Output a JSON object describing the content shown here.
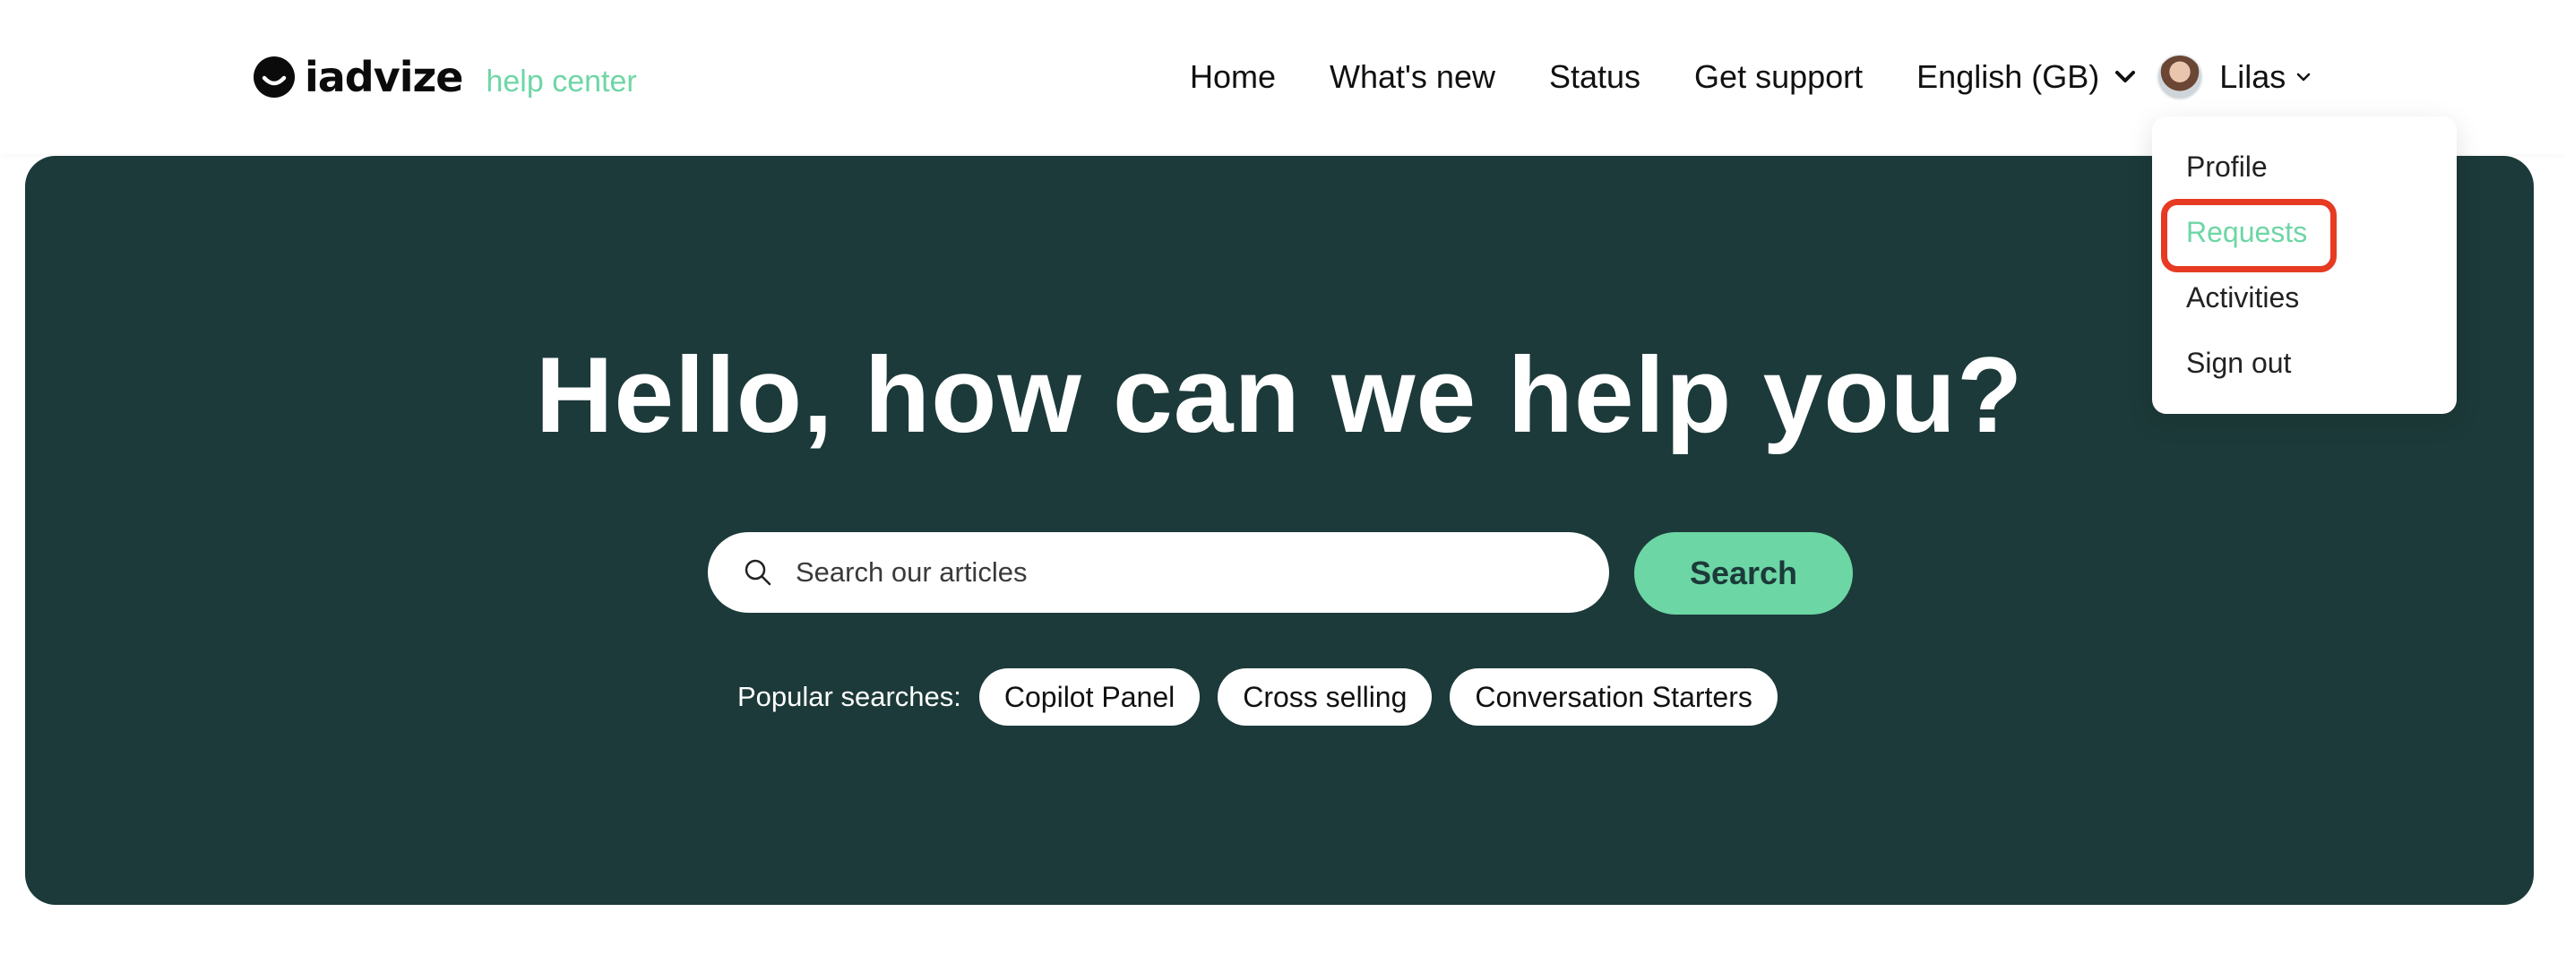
{
  "brand": {
    "logo_text": "iadvize",
    "subtitle": "help center",
    "accent_color": "#6dd6a5",
    "hero_color": "#1c3a39"
  },
  "nav": {
    "links": [
      "Home",
      "What's new",
      "Status",
      "Get support"
    ],
    "language": "English (GB)",
    "user_name": "Lilas"
  },
  "user_menu": {
    "items": [
      "Profile",
      "Requests",
      "Activities",
      "Sign out"
    ],
    "active_item": "Requests",
    "highlight_color": "#e63a23"
  },
  "hero": {
    "title": "Hello, how can we help you?",
    "search_placeholder": "Search our articles",
    "search_button": "Search",
    "popular_label": "Popular searches:",
    "popular_items": [
      "Copilot Panel",
      "Cross selling",
      "Conversation Starters"
    ]
  }
}
